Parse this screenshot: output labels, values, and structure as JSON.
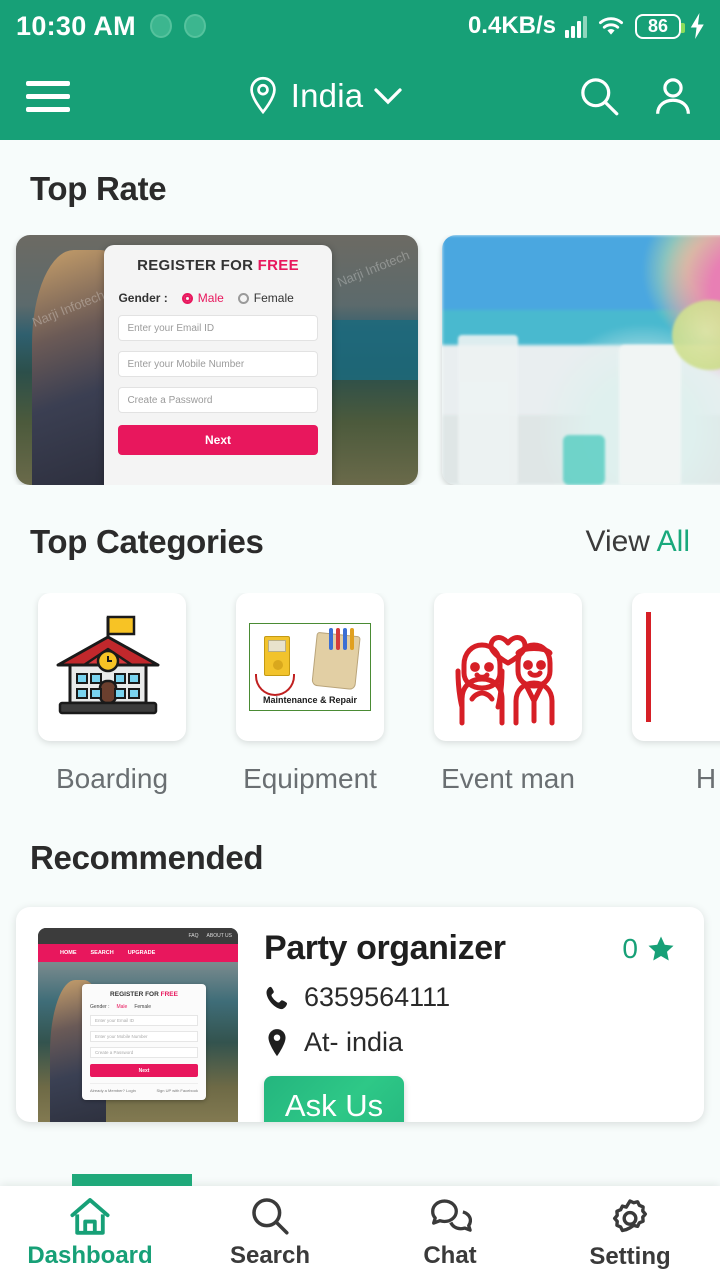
{
  "statusbar": {
    "time": "10:30 AM",
    "network_speed": "0.4KB/s",
    "battery": "86",
    "icons": [
      "notification-dot",
      "notification-dot",
      "signal-icon",
      "wifi-icon",
      "battery-icon",
      "charging-icon"
    ]
  },
  "appbar": {
    "menu_icon": "hamburger-menu-icon",
    "location_icon": "map-pin-icon",
    "location": "India",
    "chevron": "chevron-down-icon",
    "search_icon": "search-icon",
    "profile_icon": "user-profile-icon"
  },
  "top_rate": {
    "title": "Top Rate",
    "banners": [
      {
        "type": "register-form-banner",
        "form": {
          "title_prefix": "REGISTER FOR ",
          "title_highlight": "FREE",
          "gender_label": "Gender :",
          "option_male": "Male",
          "option_female": "Female",
          "email_placeholder": "Enter your Email ID",
          "mobile_placeholder": "Enter your Mobile Number",
          "password_placeholder": "Create a Password",
          "next_label": "Next",
          "watermark": "Narji Infotech"
        }
      },
      {
        "type": "event-decoration-photo-banner"
      }
    ]
  },
  "top_categories": {
    "title": "Top Categories",
    "view_label": "View ",
    "view_all_label": "All",
    "items": [
      {
        "label": "Boarding",
        "icon": "school-building-icon"
      },
      {
        "label": "Equipment",
        "icon": "maintenance-repair-icon",
        "caption": "Maintenance & Repair"
      },
      {
        "label": "Event man",
        "icon": "wedding-couple-icon"
      },
      {
        "label": "H",
        "icon": "red-card-icon"
      }
    ]
  },
  "recommended": {
    "title": "Recommended",
    "cards": [
      {
        "name": "Party organizer",
        "phone": "6359564111",
        "phone_icon": "phone-icon",
        "location": "At- india",
        "location_icon": "map-pin-icon",
        "rating": "0",
        "star_icon": "star-icon",
        "action_label": "Ask Us",
        "thumbnail": {
          "topnav": [
            "FAQ",
            "ABOUT US"
          ],
          "nav": [
            "HOME",
            "SEARCH",
            "UPGRADE"
          ],
          "form_title_prefix": "REGISTER FOR ",
          "form_title_highlight": "FREE",
          "gender_label": "Gender :",
          "option_male": "Male",
          "option_female": "Female",
          "email_placeholder": "Enter your Email ID",
          "mobile_placeholder": "Enter your Mobile Number",
          "password_placeholder": "Create a Password",
          "next_label": "Next",
          "footer_left": "Already a Member? Login",
          "footer_right": "Sign UP with Facebook"
        }
      }
    ]
  },
  "bottom_nav": {
    "items": [
      {
        "label": "Dashboard",
        "icon": "home-icon",
        "active": true
      },
      {
        "label": "Search",
        "icon": "search-icon",
        "active": false
      },
      {
        "label": "Chat",
        "icon": "chat-bubbles-icon",
        "active": false
      },
      {
        "label": "Setting",
        "icon": "gear-icon",
        "active": false
      }
    ]
  },
  "colors": {
    "brand_green": "#17a077",
    "accent_pink": "#e8175d",
    "background": "#f7fcfb"
  }
}
